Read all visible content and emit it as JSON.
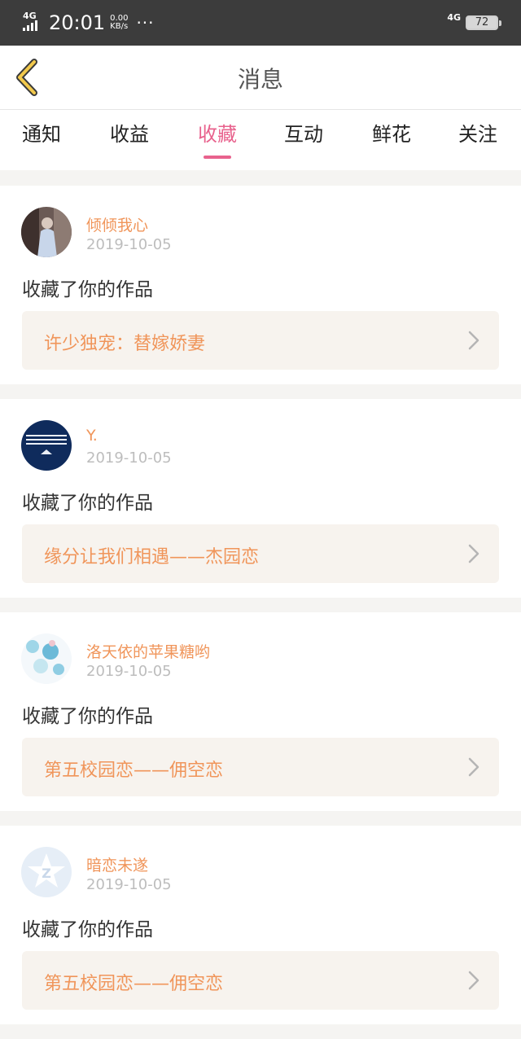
{
  "status_bar": {
    "network_left": "4G",
    "time": "20:01",
    "speed_value": "0.00",
    "speed_unit": "KB/s",
    "more": "···",
    "network_right": "4G",
    "battery": "72"
  },
  "header": {
    "title": "消息",
    "back_icon": "chevron-left-icon"
  },
  "tabs": [
    {
      "label": "通知",
      "active": false
    },
    {
      "label": "收益",
      "active": false
    },
    {
      "label": "收藏",
      "active": true
    },
    {
      "label": "互动",
      "active": false
    },
    {
      "label": "鲜花",
      "active": false
    },
    {
      "label": "关注",
      "active": false
    }
  ],
  "colors": {
    "accent_pink": "#e8628d",
    "name_orange": "#f0955a",
    "work_bg": "#f7f3ee"
  },
  "messages": [
    {
      "user": "倾倾我心",
      "date": "2019-10-05",
      "action": "收藏了你的作品",
      "work": "许少独宠：替嫁娇妻"
    },
    {
      "user": "Y.",
      "date": "2019-10-05",
      "action": "收藏了你的作品",
      "work": "缘分让我们相遇——杰园恋"
    },
    {
      "user": "洛天依的苹果糖哟",
      "date": "2019-10-05",
      "action": "收藏了你的作品",
      "work": "第五校园恋——佣空恋"
    },
    {
      "user": "暗恋未遂",
      "date": "2019-10-05",
      "action": "收藏了你的作品",
      "work": "第五校园恋——佣空恋"
    }
  ]
}
